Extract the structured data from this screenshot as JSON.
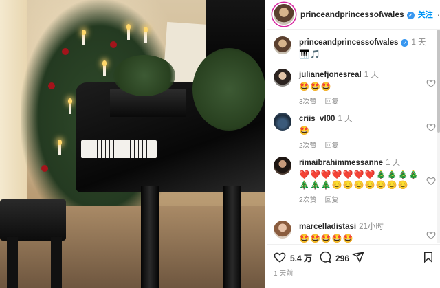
{
  "post": {
    "author": "princeandprincessofwales",
    "follow_label": "关注",
    "more_label": "···",
    "caption_author": "princeandprincessofwales",
    "caption_time": "1 天",
    "caption_text": "🎹🎵"
  },
  "comments": [
    {
      "user": "julianefjonesreal",
      "time": "1 天",
      "text": "🤩🤩🤩",
      "likes": "3次赞",
      "reply": "回复"
    },
    {
      "user": "criis_vl00",
      "time": "1 天",
      "text": "🤩",
      "likes": "2次赞",
      "reply": "回复"
    },
    {
      "user": "rimaibrahimmessanne",
      "time": "1 天",
      "text": "❤️❤️❤️❤️❤️❤️❤️🎄🎄🎄🎄🎄🎄🎄😊😊😊😊😊😊😊",
      "likes": "2次赞",
      "reply": "回复"
    },
    {
      "user": "marcelladistasi",
      "time": "21小时",
      "text": "🤩🤩🤩🤩🤩",
      "likes": "",
      "reply": ""
    }
  ],
  "actions": {
    "like_count": "5.4 万",
    "comment_count": "296"
  },
  "posted_time": "1 天前",
  "colors": {
    "accent": "#0095f6",
    "verified": "#3897f0",
    "muted": "#8e8e8e"
  },
  "icons": [
    "verified-badge-icon",
    "more-icon",
    "heart-icon",
    "comment-icon",
    "share-icon",
    "bookmark-icon"
  ]
}
